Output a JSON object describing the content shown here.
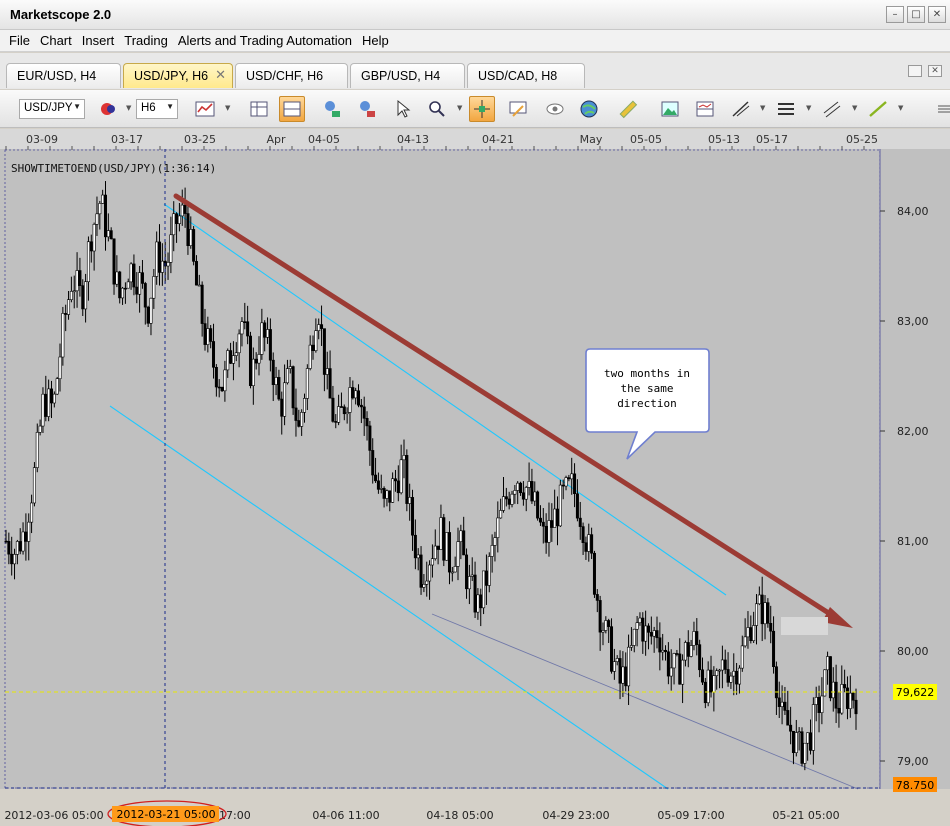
{
  "app": {
    "title": "Marketscope 2.0"
  },
  "menu": {
    "items": [
      "File",
      "Chart",
      "Insert",
      "Trading",
      "Alerts and Trading Automation",
      "Help"
    ]
  },
  "tabs": [
    {
      "label": "EUR/USD, H4",
      "active": false
    },
    {
      "label": "USD/JPY, H6",
      "active": true
    },
    {
      "label": "USD/CHF, H6",
      "active": false
    },
    {
      "label": "GBP/USD, H4",
      "active": false
    },
    {
      "label": "USD/CAD, H8",
      "active": false
    }
  ],
  "toolbar": {
    "symbol": "USD/JPY",
    "timeframe": "H6",
    "icons": [
      "chart-type-icon",
      "table-icon",
      "stacked-panes-icon",
      "buy-icon",
      "sell-icon",
      "cursor-icon",
      "zoom-icon",
      "crosshair-icon",
      "annotation-icon",
      "eye-icon",
      "globe-icon",
      "ruler-icon",
      "image-icon",
      "layout-icon",
      "trendline-icon",
      "levels-icon",
      "channel-icon",
      "line-icon",
      "more-icon"
    ]
  },
  "chart": {
    "indicator_label": "SHOWTIMETOEND(USD/JPY)(1:36:14)",
    "callout": [
      "two months in",
      "the same",
      "direction"
    ],
    "current_price": "79,622",
    "low_price": "78.750",
    "top_dates": [
      "03-09",
      "03-17",
      "03-25",
      "Apr",
      "04-05",
      "04-13",
      "04-21",
      "May",
      "05-05",
      "05-13",
      "05-17",
      "05-25"
    ],
    "bottom_times": [
      "2012-03-06 05:00",
      "03-17 17:00",
      "04-06 11:00",
      "04-18 05:00",
      "04-29 23:00",
      "05-09 17:00",
      "05-21 05:00"
    ],
    "cursor_time": "2012-03-21 05:00",
    "colors": {
      "background": "#c0c0c0",
      "arrow": "#9c3b34",
      "channel": "#1ec8ff",
      "price_marker": "#ffff00",
      "cursor_label": "#ff9a1a"
    }
  },
  "chart_data": {
    "type": "candlestick",
    "ylim": [
      78.75,
      84.3
    ],
    "y_ticks": [
      "84,00",
      "83,00",
      "82,00",
      "81,00",
      "80,00",
      "79,00"
    ],
    "y_tick_values": [
      84,
      83,
      82,
      81,
      80,
      79
    ],
    "close_path": [
      81.0,
      80.9,
      81.1,
      81.6,
      82.3,
      82.2,
      82.9,
      83.4,
      83.2,
      83.8,
      84.1,
      83.7,
      83.2,
      83.5,
      83.4,
      83.1,
      83.6,
      83.5,
      83.9,
      84.0,
      83.4,
      82.9,
      82.6,
      82.4,
      82.8,
      83.0,
      82.5,
      82.9,
      82.7,
      82.2,
      82.5,
      82.0,
      82.6,
      83.2,
      82.4,
      82.0,
      82.3,
      82.5,
      82.1,
      81.6,
      81.3,
      81.5,
      81.7,
      81.1,
      80.7,
      80.9,
      81.1,
      80.8,
      81.0,
      80.6,
      80.4,
      80.7,
      81.1,
      81.4,
      81.6,
      81.5,
      81.3,
      81.0,
      81.2,
      81.4,
      81.5,
      81.2,
      80.8,
      80.3,
      80.0,
      79.7,
      79.9,
      80.3,
      80.1,
      80.2,
      79.9,
      79.8,
      80.0,
      80.1,
      79.7,
      79.6,
      79.9,
      79.8,
      80.0,
      80.3,
      80.4,
      80.2,
      79.4,
      79.3,
      79.1,
      79.2,
      79.5,
      79.8,
      79.5,
      79.6,
      79.6
    ]
  }
}
